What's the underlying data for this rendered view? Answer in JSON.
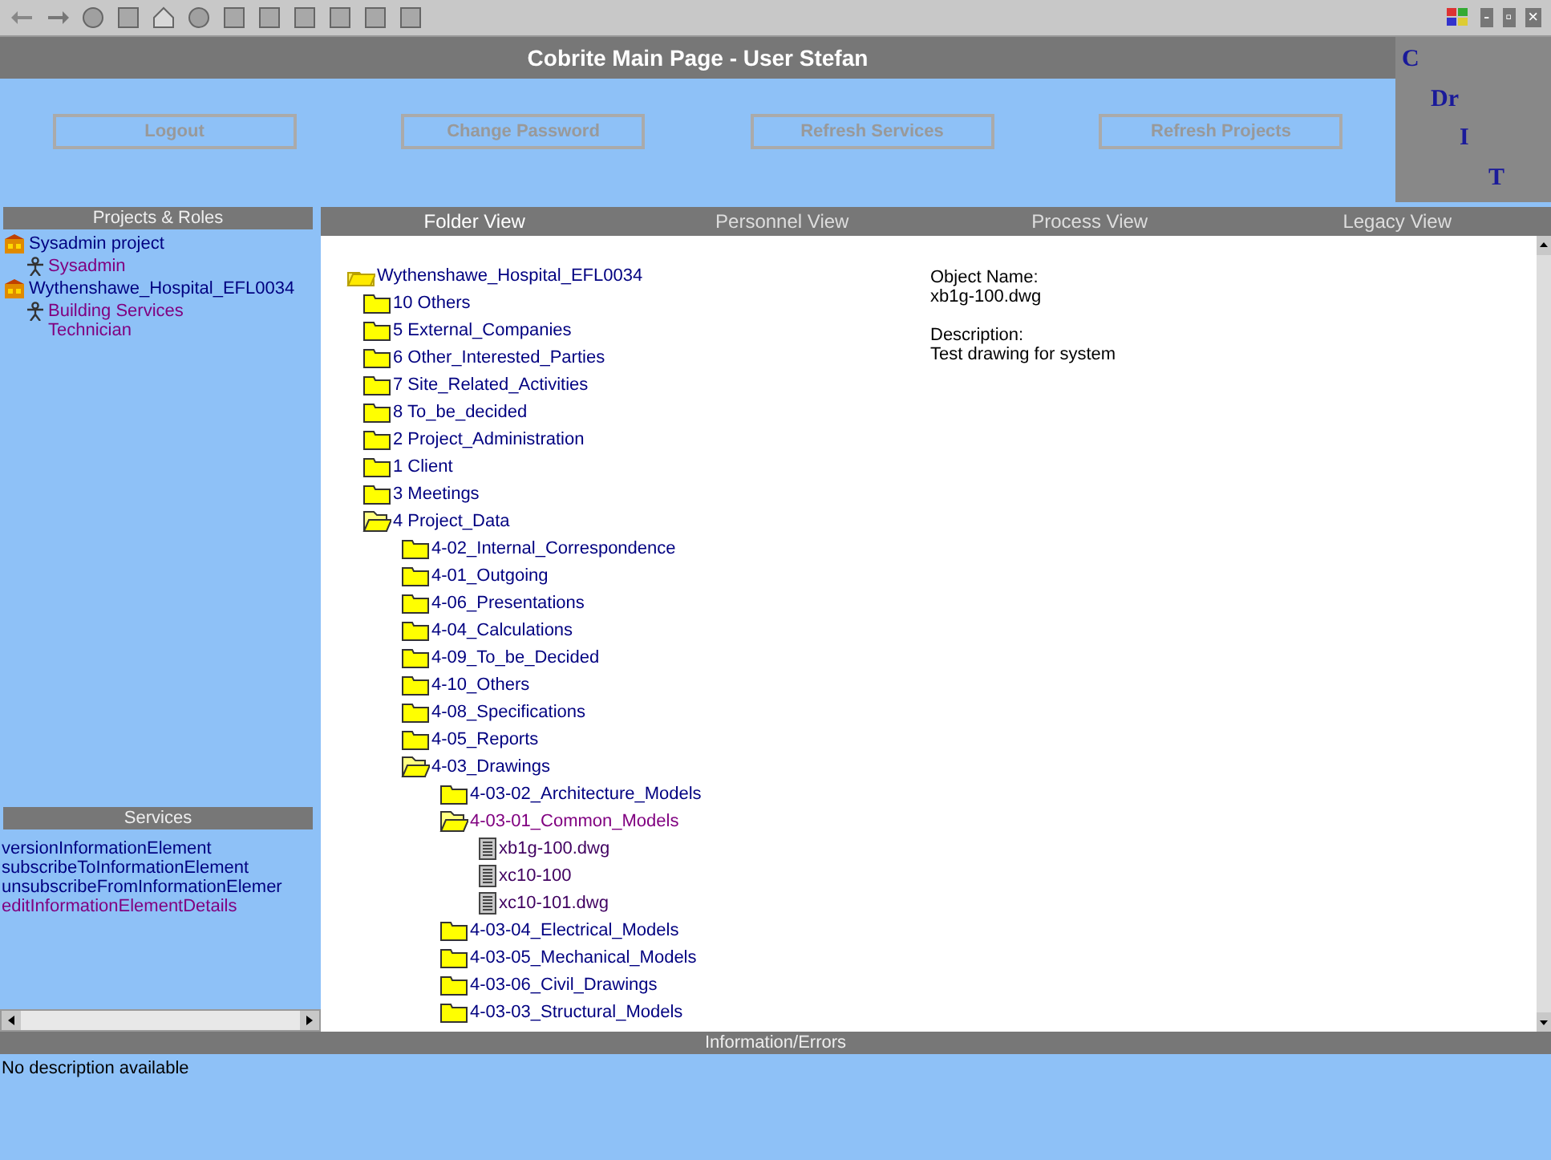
{
  "window": {
    "title": "Cobrite Main Page - User Stefan",
    "controls": [
      "-",
      "▫",
      "×"
    ]
  },
  "logo": {
    "letters": [
      "C",
      "Dr",
      "I",
      "T"
    ]
  },
  "buttons": [
    "Logout",
    "Change Password",
    "Refresh Services",
    "Refresh Projects"
  ],
  "projects": {
    "header": "Projects & Roles",
    "items": [
      {
        "label": "Sysadmin project",
        "kind": "project",
        "children": [
          {
            "label": "Sysadmin",
            "kind": "role"
          }
        ]
      },
      {
        "label": "Wythenshawe_Hospital_EFL0034",
        "kind": "project",
        "children": [
          {
            "label": "Building Services Technician",
            "kind": "role"
          }
        ]
      }
    ]
  },
  "services": {
    "header": "Services",
    "items": [
      "versionInformationElement",
      "subscribeToInformationElement",
      "unsubscribeFromInformationElemer",
      "editInformationElementDetails"
    ]
  },
  "tabs": [
    {
      "label": "Folder View",
      "selected": true
    },
    {
      "label": "Personnel View",
      "selected": false
    },
    {
      "label": "Process View",
      "selected": false
    },
    {
      "label": "Legacy View",
      "selected": false
    }
  ],
  "folder_view": {
    "tree": [
      {
        "label": "Wythenshawe_Hospital_EFL0034",
        "kind": "root",
        "expanded": true,
        "selected": false,
        "children": [
          {
            "label": "10 Others",
            "kind": "folder",
            "expanded": false,
            "selected": false
          },
          {
            "label": "5 External_Companies",
            "kind": "folder",
            "expanded": false,
            "selected": false
          },
          {
            "label": "6 Other_Interested_Parties",
            "kind": "folder",
            "expanded": false,
            "selected": false
          },
          {
            "label": "7 Site_Related_Activities",
            "kind": "folder",
            "expanded": false,
            "selected": false
          },
          {
            "label": "8 To_be_decided",
            "kind": "folder",
            "expanded": false,
            "selected": false
          },
          {
            "label": "2 Project_Administration",
            "kind": "folder",
            "expanded": false,
            "selected": false
          },
          {
            "label": "1 Client",
            "kind": "folder",
            "expanded": false,
            "selected": false
          },
          {
            "label": "3 Meetings",
            "kind": "folder",
            "expanded": false,
            "selected": false
          },
          {
            "label": "4 Project_Data",
            "kind": "folder",
            "expanded": true,
            "selected": false,
            "children": [
              {
                "label": "4-02_Internal_Correspondence",
                "kind": "folder",
                "expanded": false,
                "selected": false
              },
              {
                "label": "4-01_Outgoing",
                "kind": "folder",
                "expanded": false,
                "selected": false
              },
              {
                "label": "4-06_Presentations",
                "kind": "folder",
                "expanded": false,
                "selected": false
              },
              {
                "label": "4-04_Calculations",
                "kind": "folder",
                "expanded": false,
                "selected": false
              },
              {
                "label": "4-09_To_be_Decided",
                "kind": "folder",
                "expanded": false,
                "selected": false
              },
              {
                "label": "4-10_Others",
                "kind": "folder",
                "expanded": false,
                "selected": false
              },
              {
                "label": "4-08_Specifications",
                "kind": "folder",
                "expanded": false,
                "selected": false
              },
              {
                "label": "4-05_Reports",
                "kind": "folder",
                "expanded": false,
                "selected": false
              },
              {
                "label": "4-03_Drawings",
                "kind": "folder",
                "expanded": true,
                "selected": false,
                "children": [
                  {
                    "label": "4-03-02_Architecture_Models",
                    "kind": "folder",
                    "expanded": false,
                    "selected": false
                  },
                  {
                    "label": "4-03-01_Common_Models",
                    "kind": "folder",
                    "expanded": true,
                    "selected": true,
                    "children": [
                      {
                        "label": "xb1g-100.dwg",
                        "kind": "file",
                        "selected": false
                      },
                      {
                        "label": "xc10-100",
                        "kind": "file",
                        "selected": false
                      },
                      {
                        "label": "xc10-101.dwg",
                        "kind": "file",
                        "selected": false
                      }
                    ]
                  },
                  {
                    "label": "4-03-04_Electrical_Models",
                    "kind": "folder",
                    "expanded": false,
                    "selected": false
                  },
                  {
                    "label": "4-03-05_Mechanical_Models",
                    "kind": "folder",
                    "expanded": false,
                    "selected": false
                  },
                  {
                    "label": "4-03-06_Civil_Drawings",
                    "kind": "folder",
                    "expanded": false,
                    "selected": false
                  },
                  {
                    "label": "4-03-03_Structural_Models",
                    "kind": "folder",
                    "expanded": false,
                    "selected": false
                  }
                ]
              }
            ]
          }
        ]
      }
    ],
    "details": [
      {
        "label": "Object Name:",
        "value": "xb1g-100.dwg"
      },
      {
        "label": "Description:",
        "value": "Test drawing for system"
      }
    ]
  },
  "information": {
    "header": "Information/Errors",
    "message": "No description available"
  }
}
